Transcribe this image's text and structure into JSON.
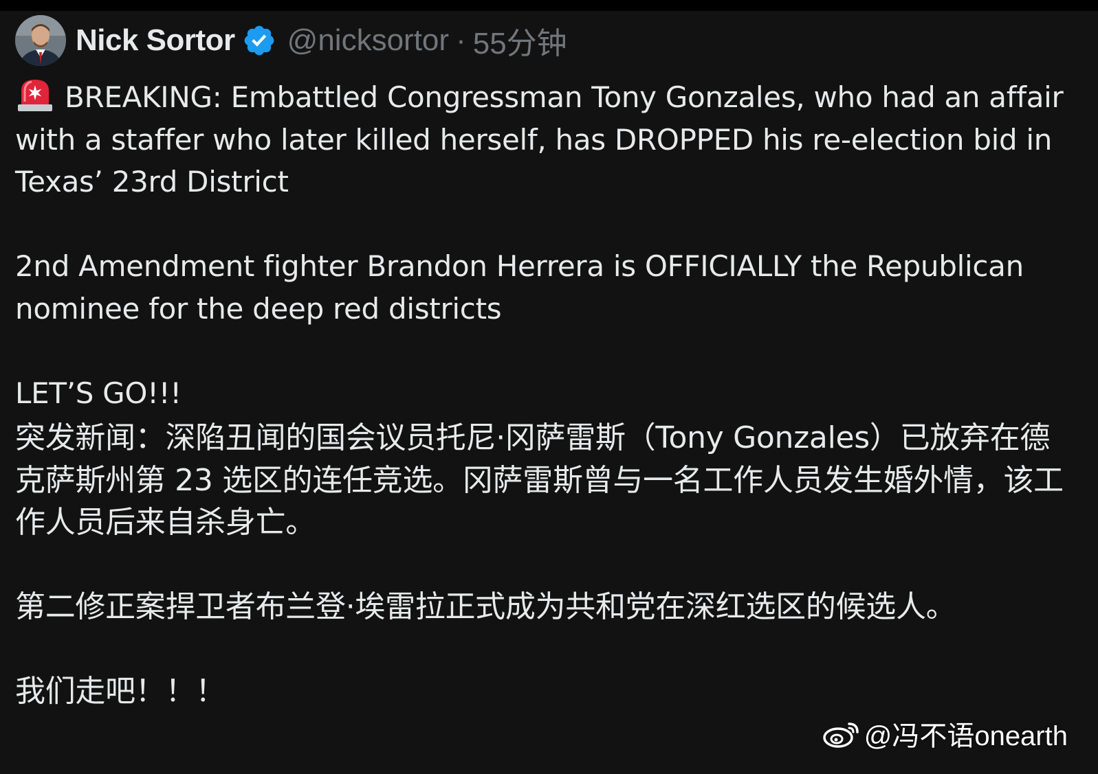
{
  "post": {
    "author_name": "Nick Sortor",
    "handle": "@nicksortor",
    "separator": "·",
    "timestamp": "55分钟",
    "verified": true,
    "icons": {
      "avatar": "avatar-photo",
      "verified": "verified-badge-icon",
      "alert": "police-siren-icon"
    },
    "paragraphs": [
      "BREAKING: Embattled Congressman Tony Gonzales, who had an affair with a staffer who later killed herself, has DROPPED his re-election bid in Texas’ 23rd District",
      "2nd Amendment fighter Brandon Herrera is OFFICIALLY the Republican nominee for the deep red districts",
      "LET’S GO!!!"
    ],
    "translation": [
      "突发新闻：深陷丑闻的国会议员托尼·冈萨雷斯（Tony Gonzales）已放弃在德克萨斯州第 23 选区的连任竞选。冈萨雷斯曾与一名工作人员发生婚外情，该工作人员后来自杀身亡。",
      "第二修正案捍卫者布兰登·埃雷拉正式成为共和党在深红选区的候选人。",
      "我们走吧！！！"
    ]
  },
  "watermark": {
    "icon": "weibo-logo-icon",
    "text": "@冯不语onearth"
  },
  "colors": {
    "background": "#121212",
    "text": "#e7e9ea",
    "muted": "#71767b",
    "verified_blue": "#1d9bf0",
    "siren_red": "#e0243a"
  }
}
